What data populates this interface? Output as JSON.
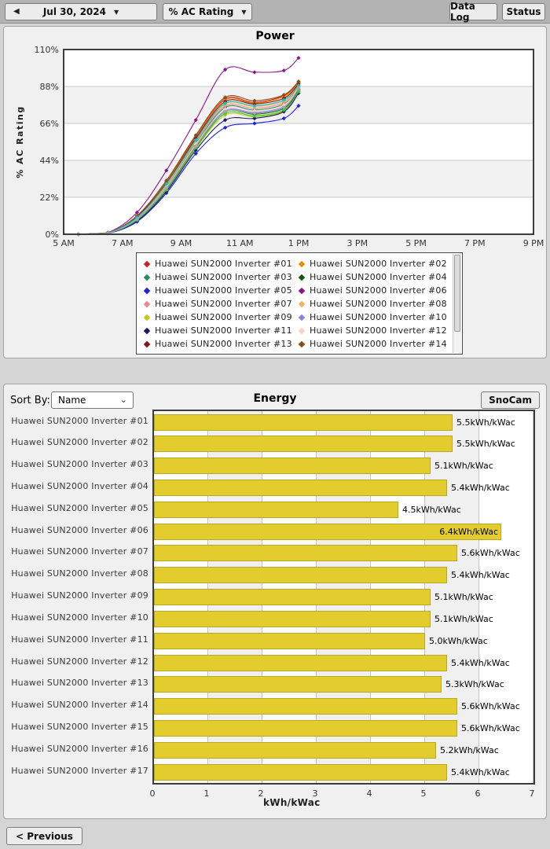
{
  "toolbar": {
    "date_label": "Jul 30, 2024",
    "metric_label": "% AC Rating",
    "data_log_label": "Data Log",
    "status_label": "Status"
  },
  "icons": {
    "prev_day_arrow": "◀",
    "caret_down": "▼",
    "select_chevron": "⌄"
  },
  "legend": {
    "visible_count": 14
  },
  "energy_panel": {
    "sort_by_label": "Sort By:",
    "sort_value": "Name",
    "snocam_label": "SnoCam"
  },
  "footer": {
    "previous_label": "< Previous"
  },
  "chart_data": [
    {
      "type": "line",
      "title": "Power",
      "ylabel": "% AC Rating",
      "xlim_hours": [
        5,
        21
      ],
      "ylim": [
        0,
        110
      ],
      "grid": true,
      "band_fill": [
        "#ffffff",
        "#f2f2f2"
      ],
      "x_ticks": [
        {
          "h": 5,
          "label": "5 AM"
        },
        {
          "h": 7,
          "label": "7 AM"
        },
        {
          "h": 9,
          "label": "9 AM"
        },
        {
          "h": 11,
          "label": "11 AM"
        },
        {
          "h": 13,
          "label": "1 PM"
        },
        {
          "h": 15,
          "label": "3 PM"
        },
        {
          "h": 17,
          "label": "5 PM"
        },
        {
          "h": 19,
          "label": "7 PM"
        },
        {
          "h": 21,
          "label": "9 PM"
        }
      ],
      "y_ticks": [
        {
          "v": 0,
          "label": "0%"
        },
        {
          "v": 22,
          "label": "22%"
        },
        {
          "v": 44,
          "label": "44%"
        },
        {
          "v": 66,
          "label": "66%"
        },
        {
          "v": 88,
          "label": "88%"
        },
        {
          "v": 110,
          "label": "110%"
        }
      ],
      "x_hours": [
        5.5,
        6.5,
        7.5,
        8.5,
        9.5,
        10.5,
        11.5,
        12.5,
        13.0
      ],
      "series": [
        {
          "name": "Huawei SUN2000 Inverter #01",
          "color": "#cc1f24",
          "values": [
            0,
            0.8,
            11,
            31.5,
            58,
            80.5,
            78.5,
            82.5,
            90.5
          ]
        },
        {
          "name": "Huawei SUN2000 Inverter #02",
          "color": "#ee8806",
          "values": [
            0,
            0.8,
            10.5,
            31,
            57.5,
            80,
            78,
            82,
            90
          ]
        },
        {
          "name": "Huawei SUN2000 Inverter #03",
          "color": "#1f9158",
          "values": [
            0,
            0.6,
            9.5,
            28.5,
            54,
            75.5,
            74,
            77.5,
            87.5
          ]
        },
        {
          "name": "Huawei SUN2000 Inverter #04",
          "color": "#14530f",
          "values": [
            0,
            0.6,
            8.5,
            27,
            52,
            73,
            71.5,
            75,
            86
          ]
        },
        {
          "name": "Huawei SUN2000 Inverter #05",
          "color": "#2020e4",
          "values": [
            0,
            0.5,
            7.5,
            24.5,
            48,
            63.5,
            66,
            69,
            76.5
          ]
        },
        {
          "name": "Huawei SUN2000 Inverter #06",
          "color": "#8e148e",
          "values": [
            0,
            1,
            13,
            38,
            68,
            98,
            96.5,
            97.5,
            105
          ]
        },
        {
          "name": "Huawei SUN2000 Inverter #07",
          "color": "#f68484",
          "values": [
            0,
            0.7,
            9.5,
            29,
            55,
            76.5,
            75,
            78.5,
            88.5
          ]
        },
        {
          "name": "Huawei SUN2000 Inverter #08",
          "color": "#f5b261",
          "values": [
            0,
            0.7,
            10,
            29.5,
            55.5,
            77.5,
            76,
            79.5,
            89
          ]
        },
        {
          "name": "Huawei SUN2000 Inverter #09",
          "color": "#c6ca16",
          "values": [
            0,
            0.5,
            8.5,
            26,
            51,
            71,
            70,
            73.5,
            85.5
          ]
        },
        {
          "name": "Huawei SUN2000 Inverter #10",
          "color": "#8585f2",
          "values": [
            0,
            0.6,
            9,
            27.5,
            53,
            73.5,
            72.5,
            76,
            86.5
          ]
        },
        {
          "name": "Huawei SUN2000 Inverter #11",
          "color": "#191968",
          "values": [
            0,
            0.5,
            8,
            25.5,
            50,
            68,
            69,
            73,
            84
          ]
        },
        {
          "name": "Huawei SUN2000 Inverter #12",
          "color": "#f8cfc0",
          "values": [
            0,
            0.6,
            9,
            28,
            53.5,
            74.5,
            73.5,
            77,
            87.5
          ]
        },
        {
          "name": "Huawei SUN2000 Inverter #13",
          "color": "#8c1212",
          "values": [
            0,
            0.7,
            10.5,
            30.5,
            57,
            79,
            77.5,
            81,
            89.5
          ]
        },
        {
          "name": "Huawei SUN2000 Inverter #14",
          "color": "#8c4d12",
          "values": [
            0,
            0.8,
            11,
            32,
            59,
            81.5,
            79.5,
            83,
            91
          ]
        },
        {
          "name": "Huawei SUN2000 Inverter #15",
          "color": "#0cc4c4",
          "values": [
            0,
            0.7,
            10,
            30,
            56,
            78,
            76.5,
            80,
            88.5
          ]
        },
        {
          "name": "Huawei SUN2000 Inverter #16",
          "color": "#37c937",
          "values": [
            0,
            0.6,
            8.5,
            26.5,
            51.5,
            72,
            70.5,
            74,
            85
          ]
        },
        {
          "name": "Huawei SUN2000 Inverter #17",
          "color": "#a5a5a5",
          "values": [
            0,
            0.6,
            9,
            27.5,
            52.5,
            73,
            72,
            75.5,
            87
          ]
        }
      ]
    },
    {
      "type": "bar",
      "orientation": "horizontal",
      "title": "Energy",
      "xlabel": "kWh/kWac",
      "xlim": [
        0,
        7
      ],
      "x_ticks": [
        "0",
        "1",
        "2",
        "3",
        "4",
        "5",
        "6",
        "7"
      ],
      "bar_color": "#e3cc2e",
      "categories": [
        "Huawei SUN2000 Inverter #01",
        "Huawei SUN2000 Inverter #02",
        "Huawei SUN2000 Inverter #03",
        "Huawei SUN2000 Inverter #04",
        "Huawei SUN2000 Inverter #05",
        "Huawei SUN2000 Inverter #06",
        "Huawei SUN2000 Inverter #07",
        "Huawei SUN2000 Inverter #08",
        "Huawei SUN2000 Inverter #09",
        "Huawei SUN2000 Inverter #10",
        "Huawei SUN2000 Inverter #11",
        "Huawei SUN2000 Inverter #12",
        "Huawei SUN2000 Inverter #13",
        "Huawei SUN2000 Inverter #14",
        "Huawei SUN2000 Inverter #15",
        "Huawei SUN2000 Inverter #16",
        "Huawei SUN2000 Inverter #17"
      ],
      "values": [
        5.5,
        5.5,
        5.1,
        5.4,
        4.5,
        6.4,
        5.6,
        5.4,
        5.1,
        5.1,
        5.0,
        5.4,
        5.3,
        5.6,
        5.6,
        5.2,
        5.4
      ],
      "value_labels": [
        "5.5kWh/kWac",
        "5.5kWh/kWac",
        "5.1kWh/kWac",
        "5.4kWh/kWac",
        "4.5kWh/kWac",
        "6.4kWh/kWac",
        "5.6kWh/kWac",
        "5.4kWh/kWac",
        "5.1kWh/kWac",
        "5.1kWh/kWac",
        "5.0kWh/kWac",
        "5.4kWh/kWac",
        "5.3kWh/kWac",
        "5.6kWh/kWac",
        "5.6kWh/kWac",
        "5.2kWh/kWac",
        "5.4kWh/kWac"
      ]
    }
  ]
}
